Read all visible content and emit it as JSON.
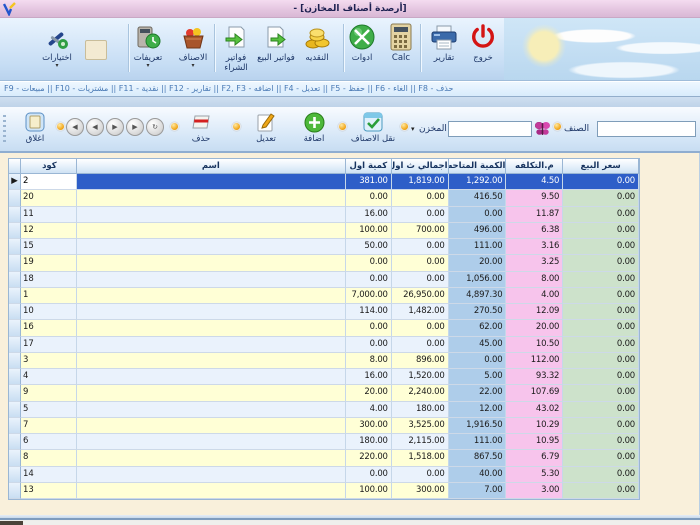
{
  "window": {
    "title": "[أرصدة أصناف المخازن] -"
  },
  "toolbar_main": {
    "buttons": [
      {
        "label": "اختيارات",
        "has_caret": true
      },
      {
        "label": "تعريفات",
        "has_caret": true
      },
      {
        "label": "الاصناف",
        "has_caret": true
      },
      {
        "label": "فواتير الشراء",
        "has_caret": false
      },
      {
        "label": "فواتير البيع",
        "has_caret": false
      },
      {
        "label": "النقديه",
        "has_caret": false
      },
      {
        "label": "ادوات",
        "has_caret": false
      },
      {
        "label": "Calc",
        "has_caret": false
      },
      {
        "label": "تقارير",
        "has_caret": false
      },
      {
        "label": "خروج",
        "has_caret": false
      }
    ]
  },
  "shortcut_bar": {
    "text": "حذف - F8 || الغاء - F6 || حفظ - F5 || تعديل - F4 || اضافه - F2, F3 || تقارير - F12 || نقدية - F11 || مشتريات - F10 || مبيعات - F9"
  },
  "toolbar_actions": {
    "close_label": "اغلاق",
    "delete_label": "حذف",
    "edit_label": "تعديل",
    "add_label": "اضافة",
    "move_items_label": "نقل الاصناف",
    "store_label": "المخزن",
    "store_value": "",
    "item_label": "الصنف",
    "item_value": ""
  },
  "icons": {
    "caret": "▾",
    "row_pointer": "▶",
    "nav": [
      "◀",
      "◀",
      "▶",
      "▶",
      "↻"
    ]
  },
  "colors": {
    "selected_row": "#2e5ec8",
    "stripe_yellow": "#ffffd6",
    "stripe_blue": "#eaf2fc",
    "available_col": "#aecdea",
    "cost_col": "#f7c4ec",
    "price_col": "#cde2cb",
    "titlebar_pink": "#e3c4df",
    "accent_dot": "#f2a71b"
  },
  "table": {
    "columns": [
      "",
      "كود",
      "اسم",
      "كمية اول",
      "اجمالي ث اول",
      "الكمية المتاحه",
      "م.التكلفه",
      "سعر البيع"
    ],
    "rows": [
      {
        "code": "2",
        "name": "",
        "qty_first": "381.00",
        "total_first": "1,819.00",
        "qty_available": "1,292.00",
        "unit_cost": "4.50",
        "sale_price": "0.00",
        "selected": true
      },
      {
        "code": "20",
        "name": "",
        "qty_first": "0.00",
        "total_first": "0.00",
        "qty_available": "416.50",
        "unit_cost": "9.50",
        "sale_price": "0.00",
        "selected": false
      },
      {
        "code": "11",
        "name": "",
        "qty_first": "16.00",
        "total_first": "0.00",
        "qty_available": "0.00",
        "unit_cost": "11.87",
        "sale_price": "0.00",
        "selected": false
      },
      {
        "code": "12",
        "name": "",
        "qty_first": "100.00",
        "total_first": "700.00",
        "qty_available": "496.00",
        "unit_cost": "6.38",
        "sale_price": "0.00",
        "selected": false
      },
      {
        "code": "15",
        "name": "",
        "qty_first": "50.00",
        "total_first": "0.00",
        "qty_available": "111.00",
        "unit_cost": "3.16",
        "sale_price": "0.00",
        "selected": false
      },
      {
        "code": "19",
        "name": "",
        "qty_first": "0.00",
        "total_first": "0.00",
        "qty_available": "20.00",
        "unit_cost": "3.25",
        "sale_price": "0.00",
        "selected": false
      },
      {
        "code": "18",
        "name": "",
        "qty_first": "0.00",
        "total_first": "0.00",
        "qty_available": "1,056.00",
        "unit_cost": "8.00",
        "sale_price": "0.00",
        "selected": false
      },
      {
        "code": "1",
        "name": "",
        "qty_first": "7,000.00",
        "total_first": "26,950.00",
        "qty_available": "4,897.30",
        "unit_cost": "4.00",
        "sale_price": "0.00",
        "selected": false
      },
      {
        "code": "10",
        "name": "",
        "qty_first": "114.00",
        "total_first": "1,482.00",
        "qty_available": "270.50",
        "unit_cost": "12.09",
        "sale_price": "0.00",
        "selected": false
      },
      {
        "code": "16",
        "name": "",
        "qty_first": "0.00",
        "total_first": "0.00",
        "qty_available": "62.00",
        "unit_cost": "20.00",
        "sale_price": "0.00",
        "selected": false
      },
      {
        "code": "17",
        "name": "",
        "qty_first": "0.00",
        "total_first": "0.00",
        "qty_available": "45.00",
        "unit_cost": "10.50",
        "sale_price": "0.00",
        "selected": false
      },
      {
        "code": "3",
        "name": "",
        "qty_first": "8.00",
        "total_first": "896.00",
        "qty_available": "0.00",
        "unit_cost": "112.00",
        "sale_price": "0.00",
        "selected": false
      },
      {
        "code": "4",
        "name": "",
        "qty_first": "16.00",
        "total_first": "1,520.00",
        "qty_available": "5.00",
        "unit_cost": "93.32",
        "sale_price": "0.00",
        "selected": false
      },
      {
        "code": "9",
        "name": "",
        "qty_first": "20.00",
        "total_first": "2,240.00",
        "qty_available": "22.00",
        "unit_cost": "107.69",
        "sale_price": "0.00",
        "selected": false
      },
      {
        "code": "5",
        "name": "",
        "qty_first": "4.00",
        "total_first": "180.00",
        "qty_available": "12.00",
        "unit_cost": "43.02",
        "sale_price": "0.00",
        "selected": false
      },
      {
        "code": "7",
        "name": "",
        "qty_first": "300.00",
        "total_first": "3,525.00",
        "qty_available": "1,916.50",
        "unit_cost": "10.29",
        "sale_price": "0.00",
        "selected": false
      },
      {
        "code": "6",
        "name": "",
        "qty_first": "180.00",
        "total_first": "2,115.00",
        "qty_available": "111.00",
        "unit_cost": "10.95",
        "sale_price": "0.00",
        "selected": false
      },
      {
        "code": "8",
        "name": "",
        "qty_first": "220.00",
        "total_first": "1,518.00",
        "qty_available": "867.50",
        "unit_cost": "6.79",
        "sale_price": "0.00",
        "selected": false
      },
      {
        "code": "14",
        "name": "",
        "qty_first": "0.00",
        "total_first": "0.00",
        "qty_available": "40.00",
        "unit_cost": "5.30",
        "sale_price": "0.00",
        "selected": false
      },
      {
        "code": "13",
        "name": "",
        "qty_first": "100.00",
        "total_first": "300.00",
        "qty_available": "7.00",
        "unit_cost": "3.00",
        "sale_price": "0.00",
        "selected": false
      }
    ]
  }
}
